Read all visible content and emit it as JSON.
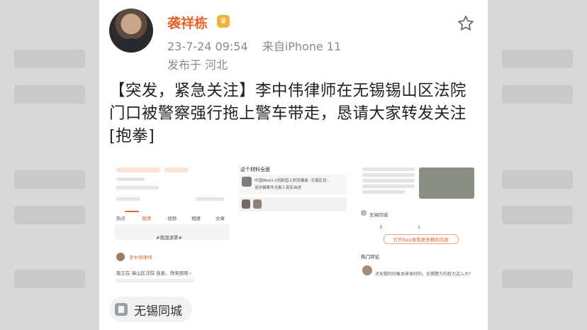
{
  "post": {
    "username": "袭祥栋",
    "timestamp": "23-7-24 09:54",
    "source": "来自iPhone 11",
    "location": "发布于 河北",
    "text": "【突发，紧急关注】李中伟律师在无锡锡山区法院门口被警察强行拖上警车带走，恳请大家转发关注[抱拳]",
    "tag": "无锡同城"
  },
  "thumbnails": {
    "left": {
      "search_placeholder": "#我国滚雾#",
      "tabs": [
        "热点",
        "微博",
        "视频",
        "相册",
        "文章"
      ],
      "post_author": "李中伟律师",
      "post_text": "我正在 锡山区法院 连麦。快来围观~"
    },
    "middle": {
      "header": "这个材料全面",
      "card_title": "中国Web3.0创新园上的受骗者 -无锡区设...",
      "card_sub": "设诈骗案件当事人真实自述"
    },
    "right": {
      "tag": "无锡同城",
      "stats": [
        "3",
        "1"
      ],
      "open_app": "打开App查看更多精彩内容",
      "hot_comments": "热门评论",
      "comment": "对无锡的印象本来很好的，无锡警方的权力这么大?"
    }
  },
  "icons": {
    "verified": "vip-crown-icon",
    "favorite": "star-outline-icon",
    "tag": "city-building-icon"
  },
  "colors": {
    "username": "#e8642c",
    "meta": "#8a8a8a",
    "text": "#222222"
  }
}
